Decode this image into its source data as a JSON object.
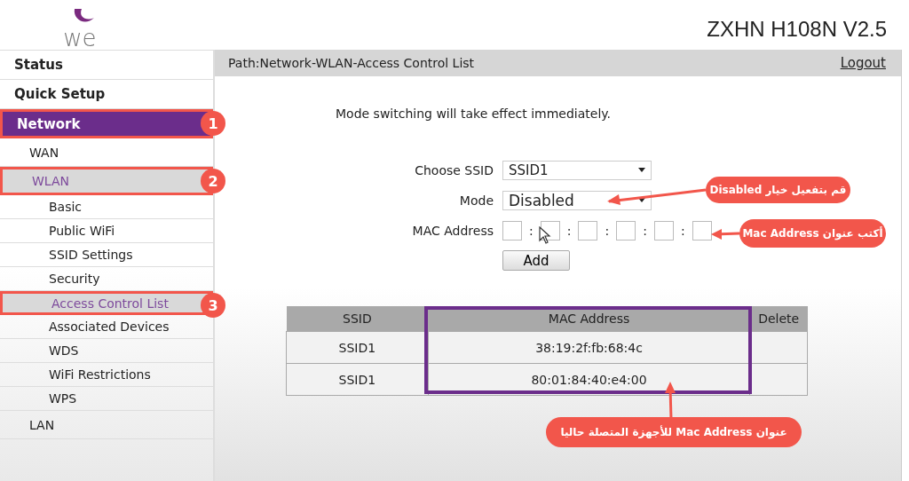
{
  "header": {
    "logo_text": "we",
    "model": "ZXHN H108N V2.5"
  },
  "sidebar": {
    "items": [
      {
        "label": "Status",
        "selected": false
      },
      {
        "label": "Quick Setup",
        "selected": false
      },
      {
        "label": "Network",
        "selected": true,
        "callout_number": "1",
        "children": [
          {
            "label": "WAN",
            "selected": false
          },
          {
            "label": "WLAN",
            "selected": true,
            "callout_number": "2",
            "children": [
              {
                "label": "Basic",
                "selected": false
              },
              {
                "label": "Public WiFi",
                "selected": false
              },
              {
                "label": "SSID Settings",
                "selected": false
              },
              {
                "label": "Security",
                "selected": false
              },
              {
                "label": "Access Control List",
                "selected": true,
                "callout_number": "3"
              },
              {
                "label": "Associated Devices",
                "selected": false
              },
              {
                "label": "WDS",
                "selected": false
              },
              {
                "label": "WiFi Restrictions",
                "selected": false
              },
              {
                "label": "WPS",
                "selected": false
              }
            ]
          },
          {
            "label": "LAN",
            "selected": false
          }
        ]
      }
    ]
  },
  "path_bar": {
    "path": "Path:Network-WLAN-Access Control List",
    "logout": "Logout"
  },
  "notice": "Mode switching will take effect immediately.",
  "form": {
    "ssid": {
      "label": "Choose SSID",
      "value": "SSID1"
    },
    "mode": {
      "label": "Mode",
      "value": "Disabled"
    },
    "mac": {
      "label": "MAC Address",
      "separators": [
        ":",
        ":",
        ":",
        ":",
        ":"
      ]
    },
    "add_button": "Add"
  },
  "table": {
    "columns": [
      {
        "label": "SSID",
        "highlighted": false
      },
      {
        "label": "MAC Address",
        "highlighted": true
      },
      {
        "label": "Delete",
        "highlighted": false
      }
    ],
    "rows": [
      {
        "ssid": "SSID1",
        "mac": "38:19:2f:fb:68:4c"
      },
      {
        "ssid": "SSID1",
        "mac": "80:01:84:40:e4:00"
      }
    ]
  },
  "callouts": [
    {
      "text": "قم بتفعيل خيار Disabled"
    },
    {
      "text": "أكتب عنوان Mac Address"
    },
    {
      "text": "عنوان Mac Address للأجهزة المتصلة حاليا"
    }
  ]
}
